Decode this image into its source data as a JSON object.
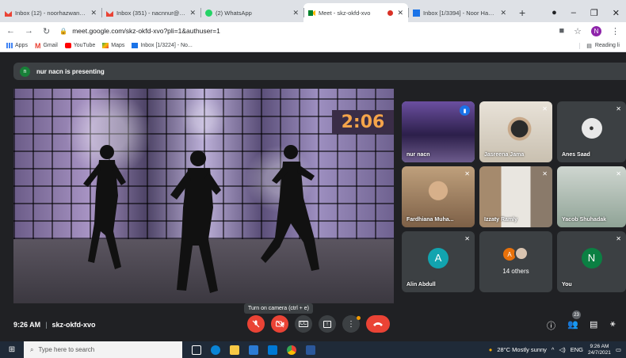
{
  "tabs": [
    {
      "title": "Inbox (12) - noorhazwan556",
      "icon": "gmail-icon",
      "active": false
    },
    {
      "title": "Inbox (351) - nacnnur@gmai",
      "icon": "gmail-icon",
      "active": false
    },
    {
      "title": "(2) WhatsApp",
      "icon": "whatsapp-icon",
      "active": false
    },
    {
      "title": "Meet - skz-okfd-xvo",
      "icon": "meet-icon",
      "active": true
    },
    {
      "title": "Inbox [1/3394] - Noor Hazwa",
      "icon": "mail-icon",
      "active": false
    }
  ],
  "address": "meet.google.com/skz-okfd-xvo?pli=1&authuser=1",
  "profile_initial": "N",
  "bookmarks": [
    "Apps",
    "Gmail",
    "YouTube",
    "Maps",
    "Inbox [1/3224] - No..."
  ],
  "reading_list": "Reading li",
  "presenting": {
    "initial": "n",
    "text": "nur nacn is presenting"
  },
  "timer": "2:06",
  "participants": [
    {
      "name": "nur nacn",
      "type": "video",
      "active": true
    },
    {
      "name": "Jasreena Jama",
      "type": "video",
      "active": false
    },
    {
      "name": "Anes Saad",
      "type": "photo",
      "active": false
    },
    {
      "name": "Fardhiana Muha...",
      "type": "video",
      "active": false
    },
    {
      "name": "Izzaty Ramly",
      "type": "video",
      "active": false
    },
    {
      "name": "Yacob Shuhadak",
      "type": "video",
      "active": false
    },
    {
      "name": "Alin Abdull",
      "type": "avatar",
      "initial": "A",
      "color": "#12a4af"
    },
    {
      "name": "14 others",
      "type": "others",
      "initial": "A",
      "color": "#e8710a"
    },
    {
      "name": "You",
      "type": "avatar",
      "initial": "N",
      "color": "#0b8043"
    }
  ],
  "meeting": {
    "time": "9:26 AM",
    "code": "skz-okfd-xvo"
  },
  "tooltip": "Turn on camera (ctrl + e)",
  "people_count": "23",
  "taskbar": {
    "search_placeholder": "Type here to search",
    "weather": "28°C  Mostly sunny",
    "lang": "ENG",
    "time": "9:26 AM",
    "date": "24/7/2021"
  }
}
